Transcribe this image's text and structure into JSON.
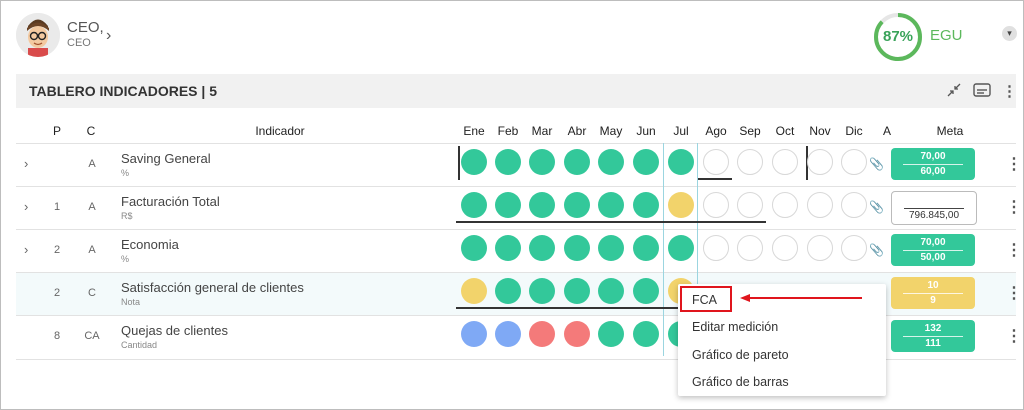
{
  "user": {
    "name": "CEO,",
    "role": "CEO"
  },
  "score": {
    "percent": "87%",
    "value": 0.87,
    "label": "EGU"
  },
  "colors": {
    "green": "#33c89a",
    "yellow": "#f2d36b",
    "red": "#f47a7a",
    "blue": "#7fa9f5"
  },
  "panel": {
    "title": "TABLERO INDICADORES | 5"
  },
  "columns": {
    "p": "P",
    "c": "C",
    "indicador": "Indicador",
    "months": [
      "Ene",
      "Feb",
      "Mar",
      "Abr",
      "May",
      "Jun",
      "Jul",
      "Ago",
      "Sep",
      "Oct",
      "Nov",
      "Dic"
    ],
    "a": "A",
    "meta": "Meta"
  },
  "rows": [
    {
      "p": "",
      "c": "A",
      "name": "Saving General",
      "unit": "%",
      "meta1": "70,00",
      "meta2": "60,00"
    },
    {
      "p": "1",
      "c": "A",
      "name": "Facturación Total",
      "unit": "R$",
      "meta1": "",
      "meta2": "796.845,00"
    },
    {
      "p": "2",
      "c": "A",
      "name": "Economia",
      "unit": "%",
      "meta1": "70,00",
      "meta2": "50,00"
    },
    {
      "p": "2",
      "c": "C",
      "name": "Satisfacción general de clientes",
      "unit": "Nota",
      "meta1": "10",
      "meta2": "9"
    },
    {
      "p": "8",
      "c": "CA",
      "name": "Quejas de clientes",
      "unit": "Cantidad",
      "meta1": "132",
      "meta2": "111"
    }
  ],
  "context_menu": {
    "items": [
      "FCA",
      "Editar medición",
      "Gráfico de pareto",
      "Gráfico de barras"
    ]
  }
}
